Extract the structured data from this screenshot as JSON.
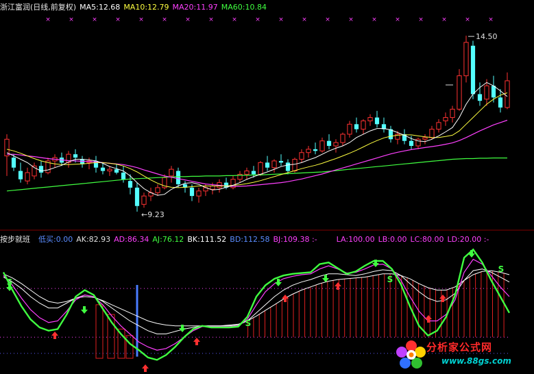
{
  "main_header": {
    "stock_name": "浙江富润(日线,前复权)",
    "ma5": "MA5:12.68",
    "ma10": "MA10:12.79",
    "ma20": "MA20:11.97",
    "ma60": "MA60:10.84"
  },
  "sub_header": {
    "indicator_name": "按步就班",
    "items": [
      {
        "text": "低买:0.00",
        "color": "#5a8cff"
      },
      {
        "text": "AK:82.93",
        "color": "#e0e0e0"
      },
      {
        "text": "AD:86.34",
        "color": "#ff40ff"
      },
      {
        "text": "AJ:76.12",
        "color": "#40ff40"
      },
      {
        "text": "BK:111.52",
        "color": "#ffffff"
      },
      {
        "text": "BD:112.58",
        "color": "#5a8cff"
      },
      {
        "text": "BJ:109.38 :-",
        "color": "#ff40ff"
      },
      {
        "text": "LA:100.00",
        "color": "#ff40ff"
      },
      {
        "text": "LB:0.00",
        "color": "#ff40ff"
      },
      {
        "text": "LC:80.00",
        "color": "#ff40ff"
      },
      {
        "text": "LD:20.00 :-",
        "color": "#ff40ff"
      }
    ]
  },
  "watermark": {
    "name": "分析家公式网",
    "url": "www.88gs.com"
  },
  "colors": {
    "up": "#ff3232",
    "down": "#54ffff",
    "ma5": "#ffffff",
    "ma10": "#ffff40",
    "ma20": "#ff40ff",
    "ma60": "#40ff40"
  },
  "chart_data": [
    {
      "type": "candlestick",
      "annotations": {
        "high_label": "14.50",
        "low_label": "9.23"
      },
      "ylim": [
        8.8,
        15.2
      ],
      "candles": [
        [
          10.9,
          11.55,
          10.3,
          11.4
        ],
        [
          10.85,
          10.95,
          10.45,
          10.55
        ],
        [
          10.45,
          10.7,
          10.1,
          10.2
        ],
        [
          10.15,
          10.55,
          10.05,
          10.4
        ],
        [
          10.3,
          10.7,
          10.2,
          10.6
        ],
        [
          10.6,
          10.75,
          10.25,
          10.4
        ],
        [
          10.4,
          10.85,
          10.35,
          10.75
        ],
        [
          10.75,
          10.95,
          10.55,
          10.85
        ],
        [
          10.85,
          11.0,
          10.6,
          10.7
        ],
        [
          10.7,
          11.05,
          10.55,
          10.95
        ],
        [
          10.95,
          11.1,
          10.7,
          10.85
        ],
        [
          10.8,
          10.9,
          10.55,
          10.65
        ],
        [
          10.7,
          10.85,
          10.5,
          10.75
        ],
        [
          10.75,
          10.9,
          10.4,
          10.55
        ],
        [
          10.55,
          10.7,
          10.35,
          10.45
        ],
        [
          10.45,
          10.6,
          10.3,
          10.5
        ],
        [
          10.5,
          10.65,
          10.35,
          10.4
        ],
        [
          10.4,
          10.6,
          10.1,
          10.2
        ],
        [
          10.15,
          10.35,
          9.75,
          9.95
        ],
        [
          9.95,
          10.1,
          9.23,
          9.4
        ],
        [
          9.45,
          9.8,
          9.35,
          9.7
        ],
        [
          9.7,
          9.95,
          9.55,
          9.8
        ],
        [
          9.8,
          10.05,
          9.7,
          9.95
        ],
        [
          9.95,
          10.35,
          9.9,
          10.25
        ],
        [
          10.3,
          10.6,
          10.1,
          10.5
        ],
        [
          10.45,
          10.55,
          9.95,
          10.05
        ],
        [
          10.05,
          10.15,
          9.8,
          9.95
        ],
        [
          9.95,
          10.05,
          9.55,
          9.7
        ],
        [
          9.7,
          9.95,
          9.5,
          9.85
        ],
        [
          9.85,
          10.05,
          9.7,
          9.95
        ],
        [
          9.9,
          10.1,
          9.75,
          10.0
        ],
        [
          9.95,
          10.2,
          9.8,
          10.1
        ],
        [
          10.1,
          10.25,
          9.9,
          9.95
        ],
        [
          9.95,
          10.3,
          9.9,
          10.2
        ],
        [
          10.2,
          10.45,
          10.1,
          10.35
        ],
        [
          10.35,
          10.55,
          10.2,
          10.45
        ],
        [
          10.45,
          10.6,
          10.25,
          10.35
        ],
        [
          10.35,
          10.75,
          10.3,
          10.7
        ],
        [
          10.7,
          10.9,
          10.45,
          10.55
        ],
        [
          10.55,
          10.8,
          10.4,
          10.75
        ],
        [
          10.75,
          10.95,
          10.6,
          10.7
        ],
        [
          10.7,
          10.8,
          10.35,
          10.45
        ],
        [
          10.45,
          10.85,
          10.4,
          10.8
        ],
        [
          10.8,
          11.1,
          10.7,
          11.0
        ],
        [
          11.0,
          11.2,
          10.85,
          11.1
        ],
        [
          11.1,
          11.3,
          10.95,
          11.05
        ],
        [
          11.05,
          11.45,
          11.0,
          11.35
        ],
        [
          11.35,
          11.55,
          11.1,
          11.2
        ],
        [
          11.2,
          11.4,
          11.0,
          11.3
        ],
        [
          11.3,
          11.6,
          11.2,
          11.55
        ],
        [
          11.55,
          11.95,
          11.45,
          11.85
        ],
        [
          11.85,
          12.05,
          11.6,
          11.7
        ],
        [
          11.7,
          12.0,
          11.55,
          11.95
        ],
        [
          11.95,
          12.15,
          11.8,
          12.05
        ],
        [
          12.05,
          12.25,
          11.75,
          11.85
        ],
        [
          11.85,
          12.05,
          11.6,
          11.7
        ],
        [
          11.7,
          11.8,
          11.3,
          11.4
        ],
        [
          11.4,
          11.65,
          11.25,
          11.55
        ],
        [
          11.55,
          11.7,
          11.25,
          11.35
        ],
        [
          11.35,
          11.5,
          11.1,
          11.2
        ],
        [
          11.2,
          11.45,
          11.1,
          11.4
        ],
        [
          11.4,
          11.55,
          11.25,
          11.45
        ],
        [
          11.45,
          11.8,
          11.4,
          11.7
        ],
        [
          11.7,
          12.0,
          11.6,
          11.9
        ],
        [
          11.95,
          12.2,
          11.8,
          12.05
        ],
        [
          12.05,
          12.4,
          11.9,
          12.3
        ],
        [
          12.3,
          13.5,
          12.25,
          13.3
        ],
        [
          13.3,
          14.5,
          13.1,
          14.3
        ],
        [
          14.2,
          14.35,
          12.6,
          12.75
        ],
        [
          12.75,
          13.1,
          12.4,
          12.55
        ],
        [
          12.6,
          13.2,
          12.4,
          13.0
        ],
        [
          13.0,
          13.3,
          12.5,
          12.65
        ],
        [
          12.65,
          12.9,
          12.2,
          12.35
        ],
        [
          12.35,
          13.4,
          12.3,
          13.15
        ]
      ],
      "ma5": [
        11.0,
        10.9,
        10.8,
        10.7,
        10.55,
        10.45,
        10.48,
        10.55,
        10.62,
        10.72,
        10.8,
        10.8,
        10.78,
        10.75,
        10.68,
        10.58,
        10.52,
        10.45,
        10.3,
        10.1,
        9.92,
        9.8,
        9.72,
        9.75,
        9.9,
        10.0,
        10.08,
        10.1,
        10.05,
        9.95,
        9.88,
        9.9,
        9.96,
        10.02,
        10.1,
        10.2,
        10.28,
        10.35,
        10.42,
        10.5,
        10.58,
        10.63,
        10.65,
        10.7,
        10.78,
        10.85,
        10.95,
        11.05,
        11.13,
        11.2,
        11.3,
        11.45,
        11.55,
        11.65,
        11.72,
        11.72,
        11.68,
        11.6,
        11.52,
        11.42,
        11.35,
        11.33,
        11.4,
        11.5,
        11.62,
        11.75,
        12.05,
        12.45,
        12.75,
        12.95,
        13.1,
        13.0,
        12.85,
        12.68
      ],
      "ma10": [
        11.1,
        11.05,
        10.98,
        10.9,
        10.82,
        10.75,
        10.7,
        10.66,
        10.64,
        10.64,
        10.65,
        10.66,
        10.68,
        10.7,
        10.7,
        10.68,
        10.65,
        10.6,
        10.52,
        10.42,
        10.3,
        10.18,
        10.08,
        10.0,
        9.96,
        9.95,
        9.96,
        9.98,
        10.0,
        10.0,
        10.0,
        10.0,
        10.0,
        10.02,
        10.04,
        10.07,
        10.11,
        10.16,
        10.22,
        10.28,
        10.34,
        10.4,
        10.46,
        10.52,
        10.57,
        10.62,
        10.68,
        10.75,
        10.82,
        10.9,
        10.98,
        11.07,
        11.17,
        11.27,
        11.36,
        11.44,
        11.49,
        11.52,
        11.53,
        11.53,
        11.5,
        11.47,
        11.45,
        11.45,
        11.48,
        11.52,
        11.65,
        11.85,
        12.05,
        12.25,
        12.45,
        12.6,
        12.72,
        12.79
      ],
      "ma20": [
        10.95,
        10.95,
        10.93,
        10.9,
        10.88,
        10.85,
        10.82,
        10.8,
        10.78,
        10.76,
        10.75,
        10.74,
        10.73,
        10.72,
        10.7,
        10.68,
        10.66,
        10.64,
        10.6,
        10.55,
        10.48,
        10.42,
        10.36,
        10.3,
        10.26,
        10.22,
        10.18,
        10.14,
        10.1,
        10.06,
        10.04,
        10.02,
        10.0,
        9.99,
        9.99,
        10.0,
        10.02,
        10.04,
        10.06,
        10.08,
        10.1,
        10.13,
        10.17,
        10.21,
        10.26,
        10.31,
        10.36,
        10.42,
        10.48,
        10.54,
        10.6,
        10.66,
        10.72,
        10.78,
        10.84,
        10.9,
        10.96,
        11.01,
        11.05,
        11.09,
        11.12,
        11.15,
        11.18,
        11.21,
        11.25,
        11.29,
        11.36,
        11.45,
        11.55,
        11.65,
        11.74,
        11.83,
        11.9,
        11.97
      ],
      "ma60": [
        9.85,
        9.87,
        9.89,
        9.91,
        9.93,
        9.95,
        9.97,
        9.99,
        10.01,
        10.03,
        10.05,
        10.07,
        10.09,
        10.11,
        10.13,
        10.15,
        10.17,
        10.19,
        10.21,
        10.22,
        10.23,
        10.24,
        10.25,
        10.26,
        10.27,
        10.28,
        10.28,
        10.29,
        10.29,
        10.3,
        10.3,
        10.3,
        10.31,
        10.31,
        10.32,
        10.32,
        10.33,
        10.33,
        10.34,
        10.35,
        10.36,
        10.37,
        10.38,
        10.39,
        10.4,
        10.41,
        10.42,
        10.44,
        10.46,
        10.48,
        10.5,
        10.52,
        10.54,
        10.56,
        10.58,
        10.6,
        10.62,
        10.64,
        10.66,
        10.68,
        10.7,
        10.72,
        10.74,
        10.76,
        10.78,
        10.8,
        10.81,
        10.82,
        10.82,
        10.83,
        10.83,
        10.84,
        10.84,
        10.84
      ]
    },
    {
      "type": "line",
      "ylim": [
        -22,
        135
      ],
      "series": [
        {
          "name": "AK",
          "color": "#40ff40",
          "values": [
            100,
            78,
            58,
            42,
            32,
            28,
            30,
            48,
            70,
            78,
            72,
            55,
            38,
            24,
            12,
            4,
            -5,
            -8,
            -2,
            8,
            20,
            30,
            34,
            32,
            32,
            32,
            33,
            45,
            70,
            84,
            92,
            96,
            98,
            99,
            100,
            110,
            112,
            105,
            98,
            101,
            108,
            114,
            114,
            104,
            85,
            58,
            34,
            22,
            28,
            45,
            72,
            118,
            128,
            112,
            90,
            70,
            50
          ]
        },
        {
          "name": "AD",
          "color": "#ff40ff",
          "values": [
            96,
            84,
            68,
            54,
            44,
            38,
            40,
            52,
            66,
            72,
            70,
            60,
            46,
            34,
            24,
            14,
            8,
            4,
            6,
            12,
            20,
            28,
            33,
            33,
            33,
            33,
            34,
            42,
            60,
            76,
            86,
            92,
            95,
            97,
            98,
            104,
            108,
            104,
            99,
            100,
            104,
            109,
            110,
            104,
            90,
            70,
            52,
            40,
            40,
            48,
            66,
            100,
            116,
            110,
            96,
            82,
            70
          ]
        },
        {
          "name": "AJ",
          "color": "#ffffff",
          "values": [
            94,
            88,
            80,
            70,
            62,
            56,
            56,
            62,
            68,
            72,
            70,
            64,
            56,
            48,
            40,
            34,
            28,
            24,
            24,
            27,
            30,
            32,
            34,
            34,
            34,
            34,
            35,
            40,
            50,
            60,
            70,
            78,
            84,
            88,
            91,
            95,
            98,
            98,
            97,
            96,
            98,
            101,
            103,
            102,
            96,
            86,
            76,
            68,
            64,
            66,
            74,
            90,
            102,
            104,
            100,
            94,
            88
          ]
        },
        {
          "name": "BK",
          "color": "#ffffff",
          "values": [
            98,
            93,
            86,
            78,
            70,
            64,
            62,
            64,
            68,
            70,
            69,
            65,
            60,
            55,
            50,
            45,
            40,
            37,
            35,
            34,
            34,
            34,
            34,
            34,
            34,
            35,
            36,
            40,
            46,
            53,
            60,
            67,
            73,
            78,
            82,
            86,
            89,
            91,
            92,
            93,
            94,
            96,
            98,
            98,
            96,
            92,
            86,
            81,
            78,
            78,
            82,
            90,
            97,
            101,
            102,
            100,
            97
          ]
        }
      ]
    }
  ]
}
